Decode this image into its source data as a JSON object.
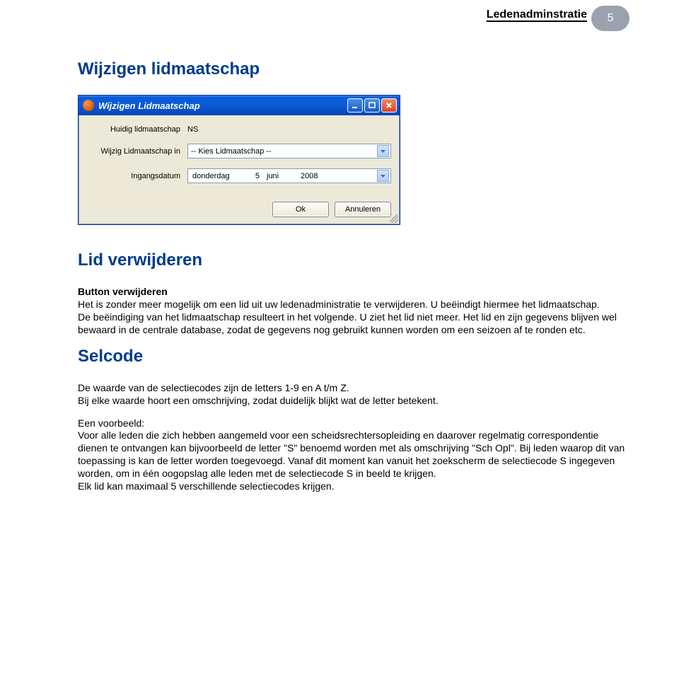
{
  "header": {
    "sectionTitle": "Ledenadminstratie",
    "pageNumber": "5"
  },
  "headings": {
    "h1_a": "Wijzigen lidmaatschap",
    "h1_b": "Lid verwijderen",
    "h1_c": "Selcode"
  },
  "dialog": {
    "windowTitle": "Wijzigen Lidmaatschap",
    "labels": {
      "current": "Huidig lidmaatschap",
      "change": "Wijzig Lidmaatschap in",
      "startDate": "Ingangsdatum"
    },
    "values": {
      "current": "NS",
      "selectPlaceholder": "-- Kies Lidmaatschap --",
      "date": {
        "weekday": "donderdag",
        "day": "5",
        "month": "juni",
        "year": "2008"
      }
    },
    "buttons": {
      "ok": "Ok",
      "cancel": "Annuleren"
    }
  },
  "text": {
    "removeSubhead": "Button verwijderen",
    "removeP1": "Het is zonder meer mogelijk om een lid uit uw ledenadministratie te verwijderen. U beëindigt hiermee het lidmaatschap.",
    "removeP2": "De beëindiging van het lidmaatschap  resulteert in het volgende. U ziet het lid niet meer. Het lid en zijn gegevens  blijven wel bewaard in de centrale database, zodat de gegevens nog gebruikt kunnen worden om een seizoen af te ronden etc.",
    "selP1": "De waarde van de selectiecodes zijn de letters 1-9 en A t/m Z.",
    "selP2": "Bij elke waarde hoort een omschrijving, zodat duidelijk blijkt wat de letter betekent.",
    "selP3a": "Een voorbeeld:",
    "selP3b": "Voor alle leden die zich hebben aangemeld voor een scheidsrechtersopleiding en daarover regelmatig correspondentie dienen te ontvangen kan bijvoorbeeld de letter \"S\" benoemd worden met als omschrijving \"Sch Opl\". Bij leden waarop dit van toepassing is kan de letter worden toegevoegd. Vanaf dit moment kan vanuit het zoekscherm de selectiecode S ingegeven worden, om in één oogopslag alle leden met de selectiecode S in beeld te krijgen.",
    "selP3c": "Elk lid kan maximaal 5 verschillende selectiecodes krijgen."
  }
}
